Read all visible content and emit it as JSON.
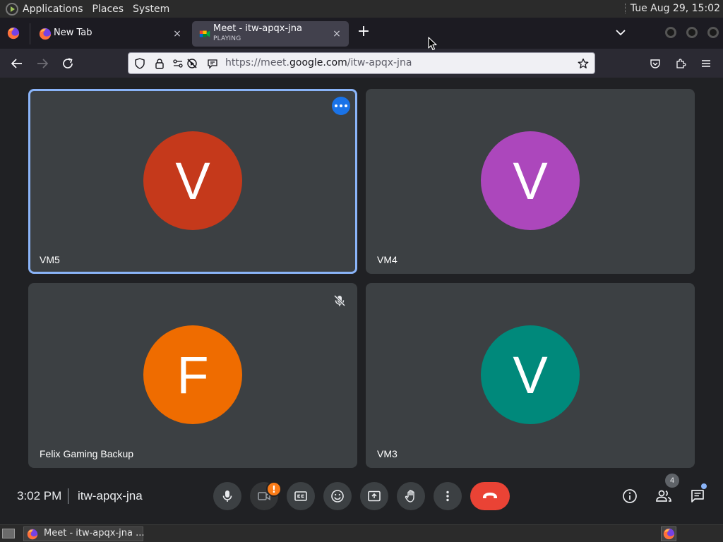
{
  "os_panel": {
    "menus": [
      "Applications",
      "Places",
      "System"
    ],
    "clock": "Tue Aug 29, 15:02"
  },
  "tabs": [
    {
      "title": "New Tab",
      "subtitle": ""
    },
    {
      "title": "Meet - itw-apqx-jna",
      "subtitle": "PLAYING"
    }
  ],
  "tab_close_glyph": "×",
  "new_tab_glyph": "+",
  "url_bar": {
    "prefix": "https://meet.",
    "domain": "google.com",
    "path": "/itw-apqx-jna"
  },
  "participants": [
    {
      "name": "VM5",
      "initial": "V",
      "color": "#c5391b"
    },
    {
      "name": "VM4",
      "initial": "V",
      "color": "#ac47bc"
    },
    {
      "name": "Felix Gaming Backup",
      "initial": "F",
      "color": "#ef6c00"
    },
    {
      "name": "VM3",
      "initial": "V",
      "color": "#00897b"
    }
  ],
  "meeting": {
    "time": "3:02 PM",
    "code": "itw-apqx-jna",
    "camera_alert": "!",
    "people_count": "4"
  },
  "taskbar": {
    "window_label": "Meet - itw-apqx-jna ..."
  },
  "colors": {
    "accent_blue": "#8ab4f8",
    "leave_red": "#ea4335",
    "alert_orange": "#fa7b17",
    "tile_bg": "#3c4043",
    "page_bg": "#202124"
  },
  "icons": [
    "firefox-icon",
    "google-meet-icon",
    "back-arrow-icon",
    "forward-arrow-icon",
    "reload-icon",
    "shield-icon",
    "lock-icon",
    "permissions-icon",
    "autoplay-blocked-icon",
    "reader-icon",
    "bookmark-star-icon",
    "pocket-icon",
    "extensions-icon",
    "hamburger-menu-icon",
    "more-options-icon",
    "mic-off-icon",
    "mic-icon",
    "camera-icon",
    "captions-icon",
    "emoji-icon",
    "present-icon",
    "raise-hand-icon",
    "more-vert-icon",
    "hang-up-icon",
    "info-icon",
    "people-icon",
    "chat-icon"
  ]
}
